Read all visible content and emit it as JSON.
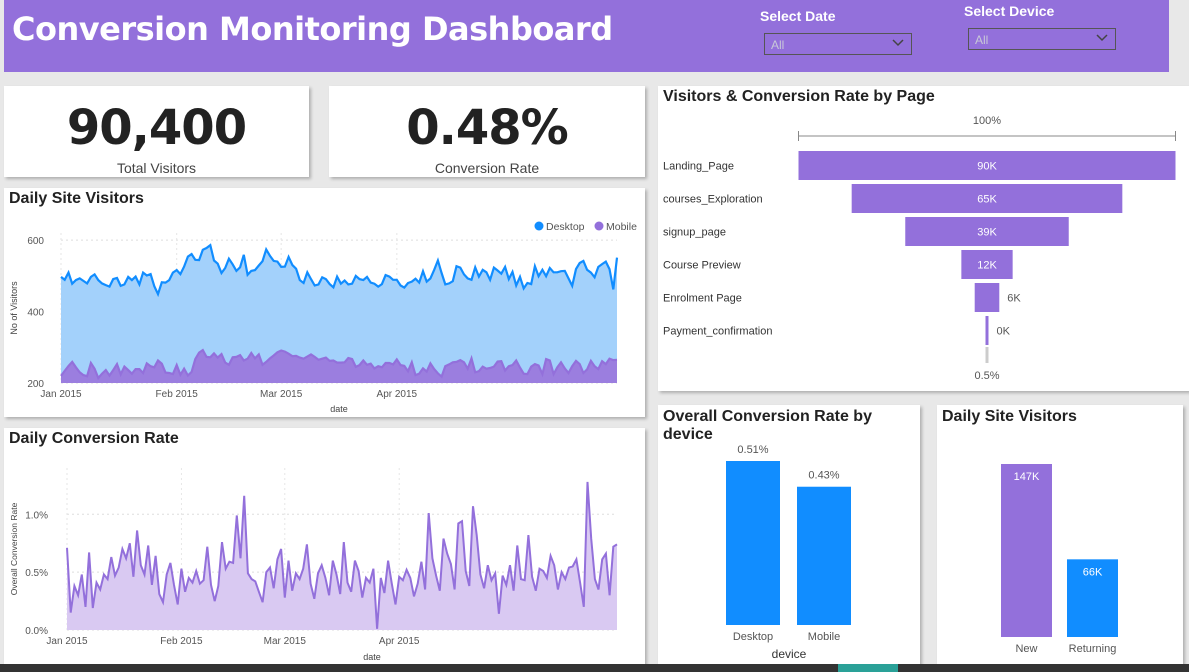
{
  "header": {
    "title": "Conversion Monitoring Dashboard",
    "date_label": "Select Date",
    "date_value": "All",
    "device_label": "Select Device",
    "device_value": "All",
    "background": "#9370db"
  },
  "kpis": {
    "visitors_value": "90,400",
    "visitors_label": "Total Visitors",
    "rate_value": "0.48%",
    "rate_label": "Conversion Rate"
  },
  "colors": {
    "desktop": "#118dff",
    "mobile": "#9370db",
    "desktop_fill": "#a3d1fb",
    "mobile_fill": "#9b79dd",
    "rate_fill": "#d9c9f2"
  },
  "chart_data": [
    {
      "type": "area",
      "title": "Daily Site Visitors",
      "xlabel": "date",
      "ylabel": "No of Visitors",
      "x_ticks": [
        "Jan 2015",
        "Feb 2015",
        "Mar 2015",
        "Apr 2015"
      ],
      "y_ticks": [
        "600",
        "400",
        "200"
      ],
      "ylim": [
        200,
        620
      ],
      "legend": [
        "Desktop",
        "Mobile"
      ],
      "legend_position": "top-right",
      "series": [
        {
          "name": "Desktop",
          "values": [
            497,
            489,
            509,
            478,
            488,
            493,
            486,
            479,
            497,
            504,
            488,
            479,
            474,
            470,
            491,
            494,
            472,
            476,
            497,
            488,
            498,
            476,
            509,
            501,
            505,
            471,
            449,
            482,
            481,
            488,
            509,
            516,
            505,
            526,
            554,
            561,
            545,
            544,
            573,
            578,
            586,
            543,
            534,
            508,
            522,
            548,
            532,
            514,
            524,
            559,
            503,
            514,
            516,
            529,
            541,
            574,
            556,
            542,
            540,
            525,
            526,
            553,
            530,
            520,
            488,
            480,
            510,
            491,
            473,
            476,
            496,
            491,
            477,
            468,
            498,
            478,
            487,
            476,
            478,
            500,
            491,
            488,
            497,
            481,
            478,
            470,
            477,
            502,
            498,
            489,
            489,
            473,
            467,
            480,
            484,
            492,
            481,
            513,
            484,
            493,
            517,
            543,
            508,
            476,
            479,
            485,
            527,
            523,
            504,
            493,
            489,
            524,
            498,
            517,
            510,
            489,
            523,
            515,
            506,
            525,
            491,
            511,
            473,
            497,
            465,
            480,
            477,
            527,
            499,
            517,
            499,
            522,
            510,
            510,
            513,
            514,
            493,
            472,
            519,
            536,
            542,
            517,
            509,
            496,
            525,
            533,
            540,
            519,
            462,
            551
          ],
          "style": "line-area"
        },
        {
          "name": "Mobile",
          "values": [
            220,
            234,
            248,
            259,
            244,
            230,
            222,
            219,
            256,
            240,
            214,
            226,
            236,
            221,
            236,
            253,
            224,
            246,
            236,
            226,
            239,
            239,
            228,
            255,
            247,
            244,
            263,
            254,
            229,
            228,
            225,
            250,
            223,
            240,
            221,
            231,
            267,
            285,
            292,
            273,
            272,
            283,
            271,
            281,
            257,
            251,
            272,
            273,
            278,
            263,
            268,
            284,
            269,
            280,
            251,
            259,
            269,
            277,
            286,
            291,
            288,
            282,
            275,
            276,
            271,
            268,
            274,
            280,
            273,
            265,
            268,
            271,
            262,
            263,
            257,
            257,
            258,
            270,
            267,
            245,
            250,
            263,
            251,
            254,
            241,
            247,
            244,
            256,
            256,
            252,
            266,
            250,
            248,
            233,
            258,
            222,
            226,
            241,
            232,
            255,
            239,
            227,
            218,
            247,
            252,
            258,
            259,
            264,
            258,
            240,
            269,
            230,
            233,
            246,
            240,
            242,
            246,
            260,
            261,
            235,
            247,
            250,
            263,
            243,
            226,
            225,
            246,
            253,
            249,
            225,
            267,
            263,
            225,
            244,
            258,
            241,
            228,
            247,
            262,
            253,
            228,
            238,
            262,
            247,
            239,
            261,
            253,
            268,
            264,
            265
          ],
          "style": "line-area"
        }
      ]
    },
    {
      "type": "area",
      "title": "Daily Conversion Rate",
      "xlabel": "date",
      "ylabel": "Overall Conversion Rate",
      "x_ticks": [
        "Jan 2015",
        "Feb 2015",
        "Mar 2015",
        "Apr 2015"
      ],
      "y_ticks": [
        "1.0%",
        "0.5%",
        "0.0%"
      ],
      "ylim": [
        0,
        1.4
      ],
      "series": [
        {
          "name": "Conversion Rate",
          "values": [
            0.71,
            0.15,
            0.38,
            0.3,
            0.48,
            0.2,
            0.67,
            0.19,
            0.41,
            0.35,
            0.48,
            0.44,
            0.63,
            0.47,
            0.54,
            0.7,
            0.62,
            0.75,
            0.46,
            0.86,
            0.56,
            0.48,
            0.73,
            0.39,
            0.64,
            0.31,
            0.24,
            0.48,
            0.58,
            0.39,
            0.22,
            0.53,
            0.33,
            0.45,
            0.41,
            0.51,
            0.4,
            0.43,
            0.72,
            0.39,
            0.25,
            0.38,
            0.76,
            0.53,
            0.59,
            0.58,
            0.99,
            0.62,
            1.16,
            0.49,
            0.44,
            0.42,
            0.33,
            0.24,
            0.5,
            0.54,
            0.36,
            0.61,
            0.7,
            0.28,
            0.6,
            0.34,
            0.49,
            0.44,
            0.53,
            0.74,
            0.4,
            0.27,
            0.49,
            0.56,
            0.45,
            0.3,
            0.6,
            0.48,
            0.31,
            0.76,
            0.41,
            0.33,
            0.6,
            0.51,
            0.28,
            0.45,
            0.41,
            0.53,
            0.01,
            0.45,
            0.32,
            0.6,
            0.4,
            0.22,
            0.46,
            0.43,
            0.52,
            0.45,
            0.29,
            0.4,
            0.59,
            0.35,
            1.01,
            0.62,
            0.47,
            0.34,
            0.79,
            0.66,
            0.57,
            0.35,
            0.92,
            0.94,
            0.51,
            0.38,
            1.07,
            0.82,
            0.48,
            0.36,
            0.56,
            0.43,
            0.49,
            0.14,
            0.47,
            0.39,
            0.56,
            0.34,
            0.73,
            0.44,
            0.43,
            0.82,
            0.46,
            0.34,
            0.53,
            0.51,
            0.45,
            0.64,
            0.56,
            0.35,
            0.5,
            0.44,
            0.54,
            0.55,
            0.61,
            0.41,
            0.2,
            1.28,
            0.79,
            0.44,
            0.35,
            0.61,
            0.66,
            0.3,
            0.72,
            0.74
          ],
          "style": "line-area"
        }
      ]
    },
    {
      "type": "funnel",
      "title": "Visitors & Conversion Rate by Page",
      "top_label": "100%",
      "bottom_label": "0.5%",
      "categories": [
        "Landing_Page",
        "courses_Exploration",
        "signup_page",
        "Course Preview",
        "Enrolment Page",
        "Payment_confirmation"
      ],
      "values": [
        90400,
        64900,
        39200,
        12300,
        5900,
        400
      ],
      "value_labels": [
        "90K",
        "65K",
        "39K",
        "12K",
        "6K",
        "0K"
      ]
    },
    {
      "type": "bar",
      "title": "Overall Conversion Rate by device",
      "xlabel": "device",
      "categories": [
        "Desktop",
        "Mobile"
      ],
      "values": [
        0.51,
        0.43
      ],
      "value_labels": [
        "0.51%",
        "0.43%"
      ],
      "colors": [
        "#118dff",
        "#118dff"
      ]
    },
    {
      "type": "bar",
      "title": "Daily Site Visitors",
      "categories": [
        "New",
        "Returning"
      ],
      "values": [
        147,
        66
      ],
      "value_labels": [
        "147K",
        "66K"
      ],
      "colors": [
        "#9370db",
        "#118dff"
      ]
    }
  ]
}
